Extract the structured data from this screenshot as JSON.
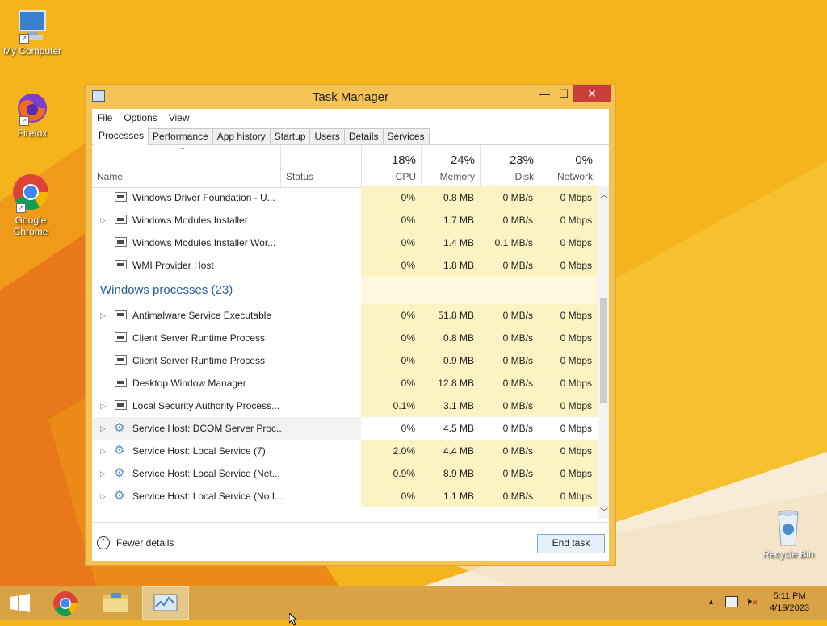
{
  "colors": {
    "desktop": "#f5b41c",
    "accent": "#2a5e9b",
    "window_frame": "#f4c255",
    "close": "#c9403a"
  },
  "desktop": {
    "icons": [
      {
        "label": "My Computer",
        "icon": "computer-icon"
      },
      {
        "label": "Firefox",
        "icon": "firefox-icon"
      },
      {
        "label": "Google Chrome",
        "icon": "chrome-icon"
      },
      {
        "label": "Recycle Bin",
        "icon": "recycle-bin-icon"
      }
    ]
  },
  "window": {
    "title": "Task Manager",
    "minimize": "—",
    "maximize": "☐",
    "close": "✕",
    "menu": [
      "File",
      "Options",
      "View"
    ],
    "tabs": [
      "Processes",
      "Performance",
      "App history",
      "Startup",
      "Users",
      "Details",
      "Services"
    ],
    "header": {
      "name": "Name",
      "status": "Status",
      "cpu_pct": "18%",
      "cpu": "CPU",
      "mem_pct": "24%",
      "mem": "Memory",
      "disk_pct": "23%",
      "disk": "Disk",
      "net_pct": "0%",
      "net": "Network"
    },
    "rows": [
      {
        "name": "Windows Driver Foundation - U...",
        "cpu": "0%",
        "mem": "0.8 MB",
        "disk": "0 MB/s",
        "net": "0 Mbps",
        "expand": false,
        "icon": "app"
      },
      {
        "name": "Windows Modules Installer",
        "cpu": "0%",
        "mem": "1.7 MB",
        "disk": "0 MB/s",
        "net": "0 Mbps",
        "expand": true,
        "icon": "app"
      },
      {
        "name": "Windows Modules Installer Wor...",
        "cpu": "0%",
        "mem": "1.4 MB",
        "disk": "0.1 MB/s",
        "net": "0 Mbps",
        "expand": false,
        "icon": "app"
      },
      {
        "name": "WMI Provider Host",
        "cpu": "0%",
        "mem": "1.8 MB",
        "disk": "0 MB/s",
        "net": "0 Mbps",
        "expand": false,
        "icon": "app"
      }
    ],
    "group": "Windows processes (23)",
    "rows2": [
      {
        "name": "Antimalware Service Executable",
        "cpu": "0%",
        "mem": "51.8 MB",
        "disk": "0 MB/s",
        "net": "0 Mbps",
        "expand": true,
        "icon": "app"
      },
      {
        "name": "Client Server Runtime Process",
        "cpu": "0%",
        "mem": "0.8 MB",
        "disk": "0 MB/s",
        "net": "0 Mbps",
        "expand": false,
        "icon": "app"
      },
      {
        "name": "Client Server Runtime Process",
        "cpu": "0%",
        "mem": "0.9 MB",
        "disk": "0 MB/s",
        "net": "0 Mbps",
        "expand": false,
        "icon": "app"
      },
      {
        "name": "Desktop Window Manager",
        "cpu": "0%",
        "mem": "12.8 MB",
        "disk": "0 MB/s",
        "net": "0 Mbps",
        "expand": false,
        "icon": "app"
      },
      {
        "name": "Local Security Authority Process...",
        "cpu": "0.1%",
        "mem": "3.1 MB",
        "disk": "0 MB/s",
        "net": "0 Mbps",
        "expand": true,
        "icon": "app"
      },
      {
        "name": "Service Host: DCOM Server Proc...",
        "cpu": "0%",
        "mem": "4.5 MB",
        "disk": "0 MB/s",
        "net": "0 Mbps",
        "expand": true,
        "icon": "gear",
        "selected": true
      },
      {
        "name": "Service Host: Local Service (7)",
        "cpu": "2.0%",
        "mem": "4.4 MB",
        "disk": "0 MB/s",
        "net": "0 Mbps",
        "expand": true,
        "icon": "gear"
      },
      {
        "name": "Service Host: Local Service (Net...",
        "cpu": "0.9%",
        "mem": "8.9 MB",
        "disk": "0 MB/s",
        "net": "0 Mbps",
        "expand": true,
        "icon": "gear"
      },
      {
        "name": "Service Host: Local Service (No I...",
        "cpu": "0%",
        "mem": "1.1 MB",
        "disk": "0 MB/s",
        "net": "0 Mbps",
        "expand": true,
        "icon": "gear"
      }
    ],
    "footer": {
      "fewer": "Fewer details",
      "end_task": "End task"
    }
  },
  "taskbar": {
    "time": "5:11 PM",
    "date": "4/19/2023"
  }
}
